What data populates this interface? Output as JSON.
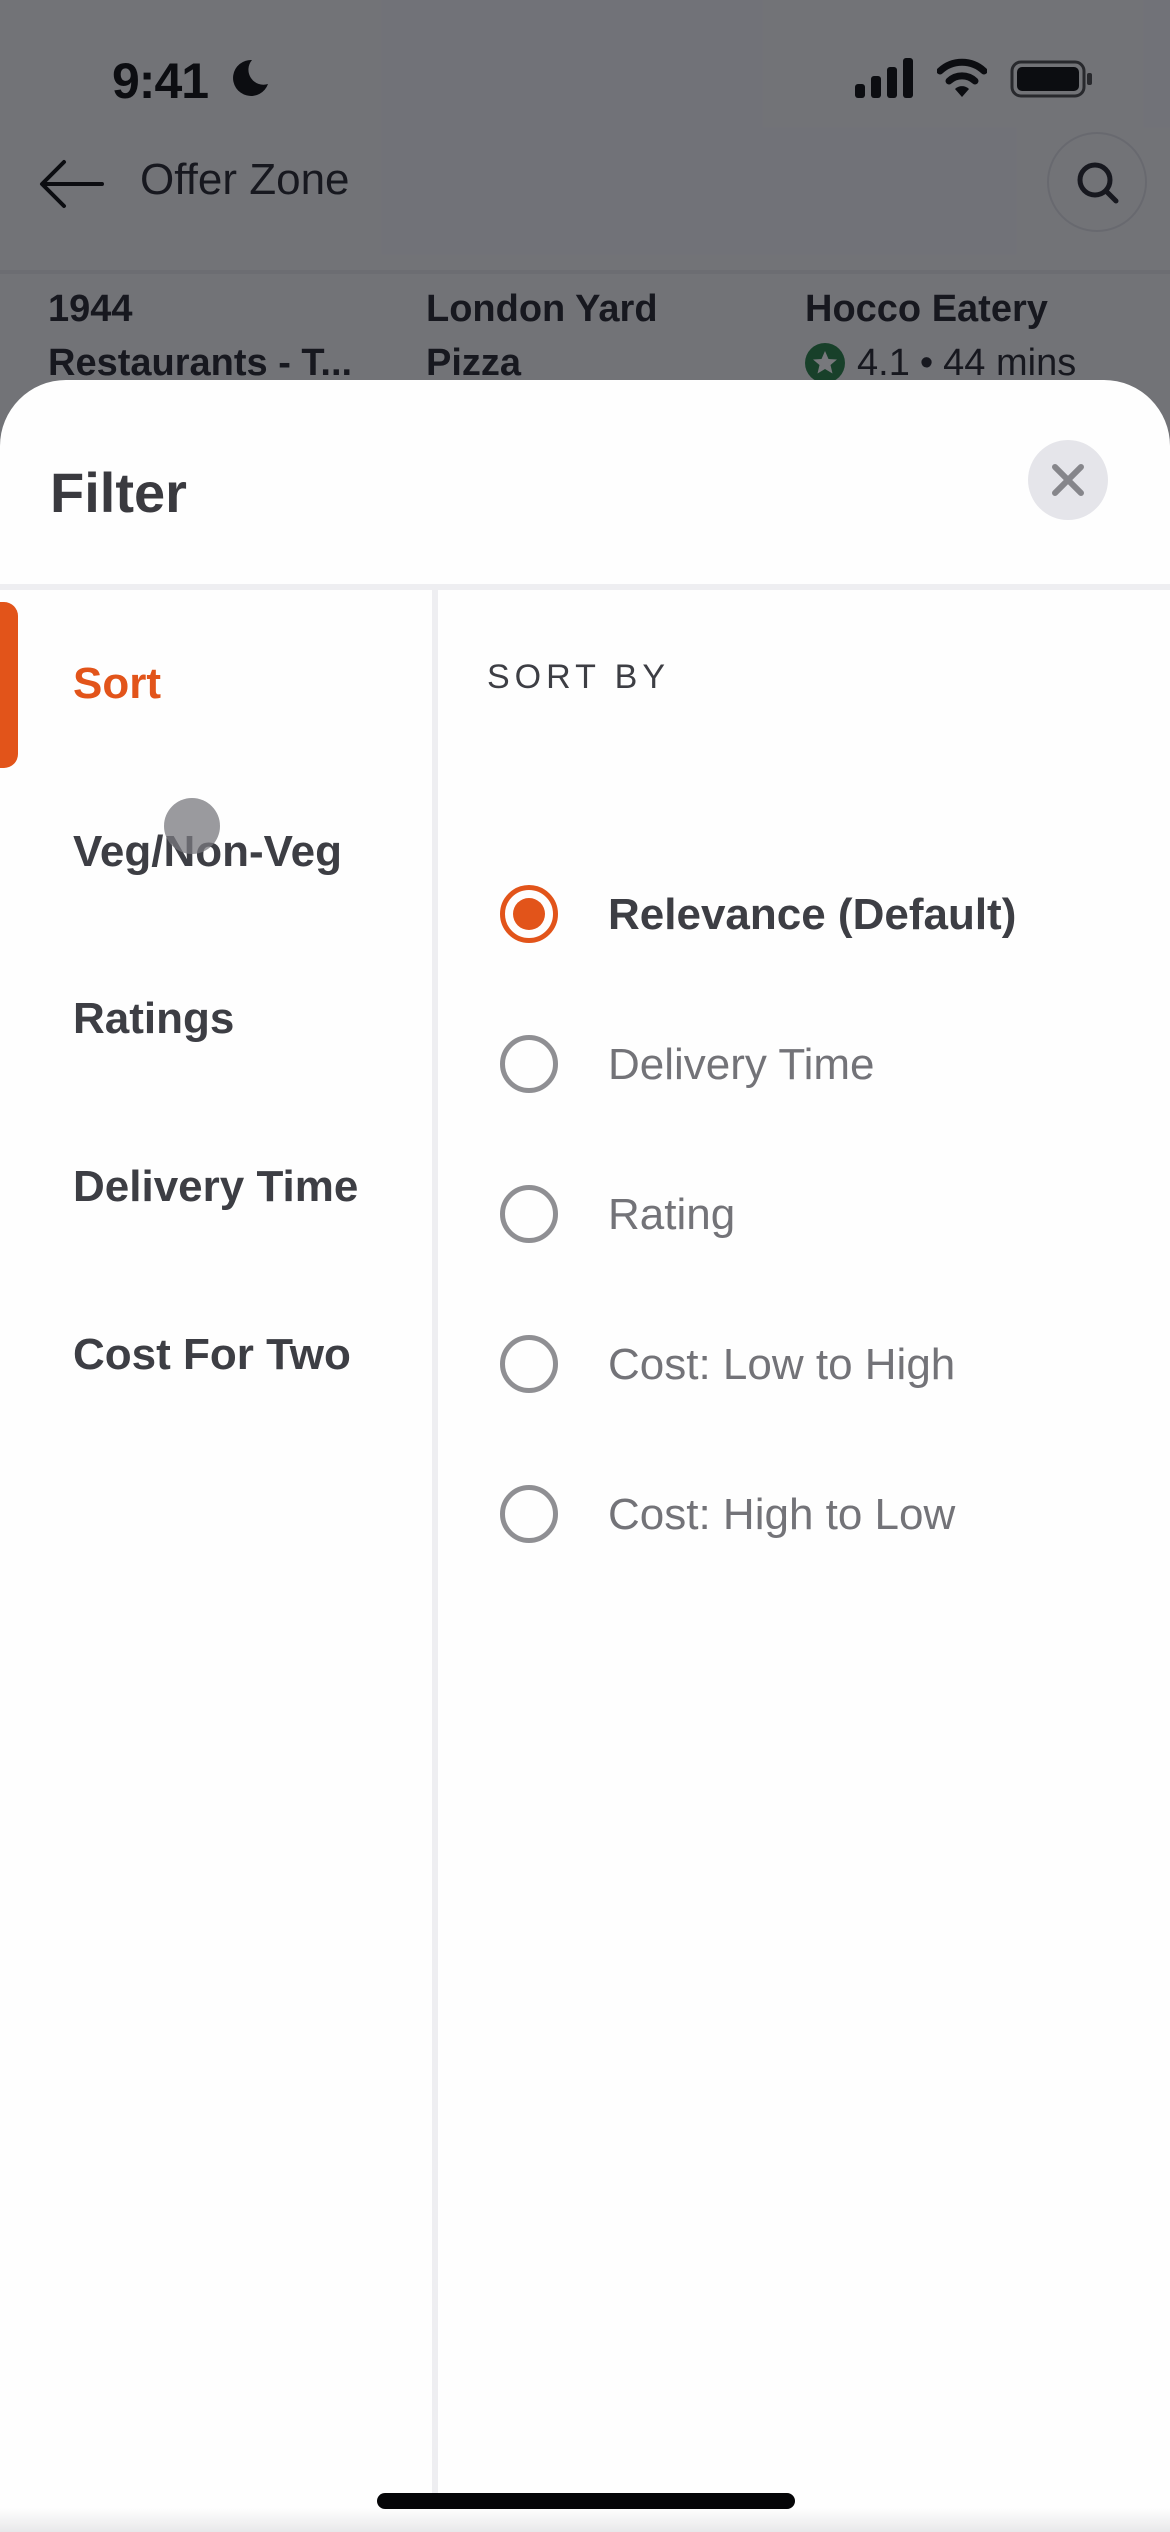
{
  "status_bar": {
    "time": "9:41",
    "focus_icon": "moon-icon",
    "signal_icon": "cellular-signal-icon",
    "wifi_icon": "wifi-icon",
    "battery_icon": "battery-icon"
  },
  "header": {
    "back_icon": "arrow-left-icon",
    "title": "Offer Zone",
    "search_icon": "search-icon"
  },
  "restaurants": [
    {
      "name_line1": "1944",
      "name_line2": "Restaurants - T..."
    },
    {
      "name_line1": "London Yard",
      "name_line2": "Pizza"
    },
    {
      "name_line1": "Hocco Eatery",
      "rating": "4.1",
      "separator": "•",
      "delivery_time": "44 mins",
      "rating_icon": "star-icon"
    }
  ],
  "filter_sheet": {
    "title": "Filter",
    "close_icon": "close-icon",
    "nav_items": [
      {
        "label": "Sort",
        "active": true
      },
      {
        "label": "Veg/Non-Veg",
        "active": false
      },
      {
        "label": "Ratings",
        "active": false
      },
      {
        "label": "Delivery Time",
        "active": false
      },
      {
        "label": "Cost For Two",
        "active": false
      }
    ],
    "sort_panel": {
      "heading": "SORT BY",
      "selected_index": 0,
      "options": [
        {
          "label": "Relevance (Default)",
          "selected": true
        },
        {
          "label": "Delivery Time",
          "selected": false
        },
        {
          "label": "Rating",
          "selected": false
        },
        {
          "label": "Cost: Low to High",
          "selected": false
        },
        {
          "label": "Cost: High to Low",
          "selected": false
        }
      ]
    }
  },
  "colors": {
    "accent": "#e2541a",
    "text_primary": "#3d3e44",
    "text_secondary": "#737378",
    "rating_green": "#1e7a3c",
    "overlay": "#67686d"
  }
}
